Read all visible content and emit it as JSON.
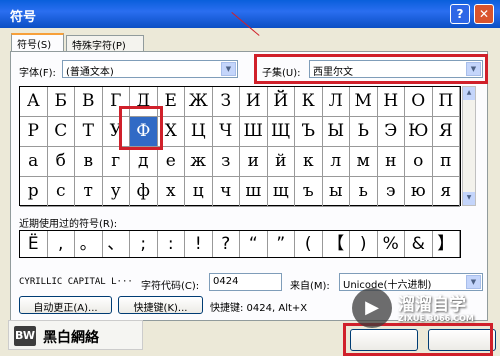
{
  "window": {
    "title": "符号",
    "help": "?",
    "close": "✕"
  },
  "tabs": [
    "符号(S)",
    "特殊字符(P)"
  ],
  "font": {
    "label": "字体(F):",
    "value": "(普通文本)"
  },
  "subset": {
    "label": "子集(U):",
    "value": "西里尔文"
  },
  "grid": [
    [
      "А",
      "Б",
      "В",
      "Г",
      "Д",
      "Е",
      "Ж",
      "З",
      "И",
      "Й",
      "К",
      "Л",
      "М",
      "Н",
      "О",
      "П"
    ],
    [
      "Р",
      "С",
      "Т",
      "У",
      "Ф",
      "Х",
      "Ц",
      "Ч",
      "Ш",
      "Щ",
      "Ъ",
      "Ы",
      "Ь",
      "Э",
      "Ю",
      "Я"
    ],
    [
      "а",
      "б",
      "в",
      "г",
      "д",
      "е",
      "ж",
      "з",
      "и",
      "й",
      "к",
      "л",
      "м",
      "н",
      "о",
      "п"
    ],
    [
      "р",
      "с",
      "т",
      "у",
      "ф",
      "х",
      "ц",
      "ч",
      "ш",
      "щ",
      "ъ",
      "ы",
      "ь",
      "э",
      "ю",
      "я"
    ]
  ],
  "recent": {
    "label": "近期使用过的符号(R):",
    "symbols": [
      "Ё",
      ",",
      "。",
      "、",
      ";",
      ":",
      "!",
      "?",
      "“",
      "”",
      "(",
      "【",
      ")",
      "%",
      "&",
      "】"
    ]
  },
  "char_name": "CYRILLIC CAPITAL L···",
  "char_code": {
    "label": "字符代码(C):",
    "value": "0424"
  },
  "from": {
    "label": "来自(M):",
    "value": "Unicode(十六进制)"
  },
  "buttons": {
    "autocorrect": "自动更正(A)...",
    "shortcut": "快捷键(K)...",
    "shortcut_text": "快捷键: 0424, Alt+X"
  },
  "logo": {
    "mark": "BW",
    "text": "黑白網絡"
  },
  "watermark": {
    "symbol": "▶",
    "title": "溜溜自学",
    "url": "ZIXUE.3066.COM"
  }
}
